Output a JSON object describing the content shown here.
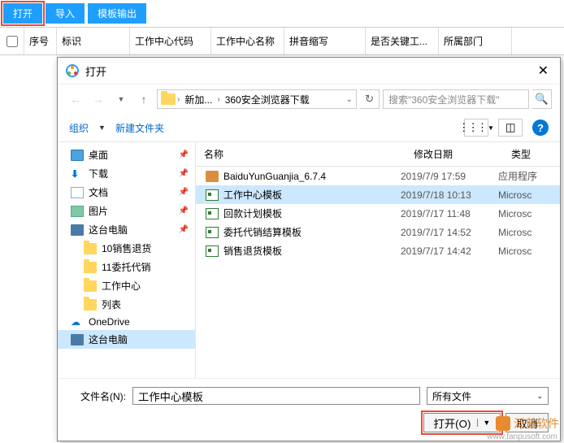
{
  "toolbar": {
    "open": "打开",
    "import": "导入",
    "template_output": "模板输出"
  },
  "table_columns": {
    "seq": "序号",
    "marker": "标识",
    "center_code": "工作中心代码",
    "center_name": "工作中心名称",
    "pinyin": "拼音缩写",
    "is_key": "是否关键工...",
    "dept": "所属部门"
  },
  "dialog": {
    "title": "打开",
    "path": {
      "seg1": "新加...",
      "seg2": "360安全浏览器下载"
    },
    "search_placeholder": "搜索\"360安全浏览器下载\"",
    "organize": "组织",
    "organize_arrow": "▼",
    "new_folder": "新建文件夹",
    "columns": {
      "name": "名称",
      "date": "修改日期",
      "type": "类型"
    },
    "tree": [
      {
        "label": "桌面",
        "icon": "desktop",
        "pinned": true
      },
      {
        "label": "下载",
        "icon": "download",
        "pinned": true
      },
      {
        "label": "文档",
        "icon": "doc",
        "pinned": true
      },
      {
        "label": "图片",
        "icon": "pic",
        "pinned": true
      },
      {
        "label": "这台电脑",
        "icon": "pc",
        "pinned": true
      },
      {
        "label": "10销售退货",
        "icon": "folder",
        "sub": true
      },
      {
        "label": "11委托代销",
        "icon": "folder",
        "sub": true
      },
      {
        "label": "工作中心",
        "icon": "folder",
        "sub": true
      },
      {
        "label": "列表",
        "icon": "folder",
        "sub": true
      },
      {
        "label": "OneDrive",
        "icon": "cloud"
      },
      {
        "label": "这台电脑",
        "icon": "pc",
        "selected": true
      }
    ],
    "files": [
      {
        "name": "BaiduYunGuanjia_6.7.4",
        "date": "2019/7/9 17:59",
        "type": "应用程序",
        "icon": "exe"
      },
      {
        "name": "工作中心模板",
        "date": "2019/7/18 10:13",
        "type": "Microsc",
        "icon": "xls",
        "selected": true
      },
      {
        "name": "回款计划模板",
        "date": "2019/7/17 11:48",
        "type": "Microsc",
        "icon": "xls"
      },
      {
        "name": "委托代销结算模板",
        "date": "2019/7/17 14:52",
        "type": "Microsc",
        "icon": "xls"
      },
      {
        "name": "销售退货模板",
        "date": "2019/7/17 14:42",
        "type": "Microsc",
        "icon": "xls"
      }
    ],
    "filename_label": "文件名(N):",
    "filename_value": "工作中心模板",
    "filter": "所有文件",
    "open_btn": "打开(O)",
    "cancel_btn": "取消"
  },
  "watermark": {
    "brand": "泛普软件",
    "url": "www.fanpusoft.com"
  }
}
